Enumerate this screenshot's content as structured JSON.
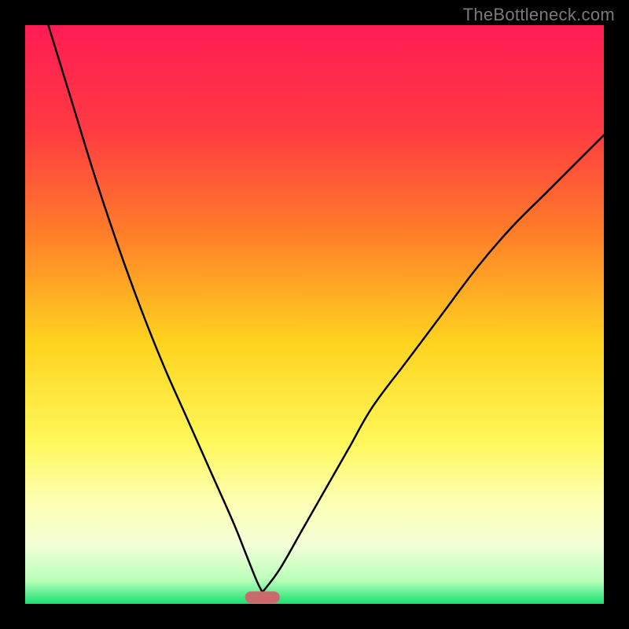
{
  "watermark": "TheBottleneck.com",
  "chart_data": {
    "type": "line",
    "title": "",
    "xlabel": "",
    "ylabel": "",
    "xlim": [
      0,
      100
    ],
    "ylim": [
      0,
      100
    ],
    "optimum_x": 41,
    "marker": {
      "x_center": 41,
      "width": 6,
      "height": 2,
      "color": "#c96a6f"
    },
    "gradient_stops": [
      {
        "offset": 0.0,
        "color": "#ff1c55"
      },
      {
        "offset": 0.18,
        "color": "#ff3a42"
      },
      {
        "offset": 0.35,
        "color": "#ff7a2a"
      },
      {
        "offset": 0.55,
        "color": "#ffd41f"
      },
      {
        "offset": 0.72,
        "color": "#fff85a"
      },
      {
        "offset": 0.82,
        "color": "#fdffb0"
      },
      {
        "offset": 0.9,
        "color": "#f3ffd8"
      },
      {
        "offset": 0.96,
        "color": "#b8ffb8"
      },
      {
        "offset": 1.0,
        "color": "#19e070"
      }
    ],
    "series": [
      {
        "name": "left-curve",
        "x": [
          4,
          8,
          12,
          16,
          20,
          24,
          28,
          32,
          36,
          38,
          40,
          41
        ],
        "y": [
          100,
          87,
          74,
          62,
          51,
          41,
          32,
          23,
          14,
          9,
          4,
          2
        ]
      },
      {
        "name": "right-curve",
        "x": [
          41,
          44,
          48,
          52,
          56,
          60,
          66,
          72,
          78,
          84,
          90,
          96,
          100
        ],
        "y": [
          2,
          6,
          13,
          20,
          27,
          34,
          42,
          50,
          58,
          65,
          71,
          77,
          81
        ]
      }
    ]
  }
}
